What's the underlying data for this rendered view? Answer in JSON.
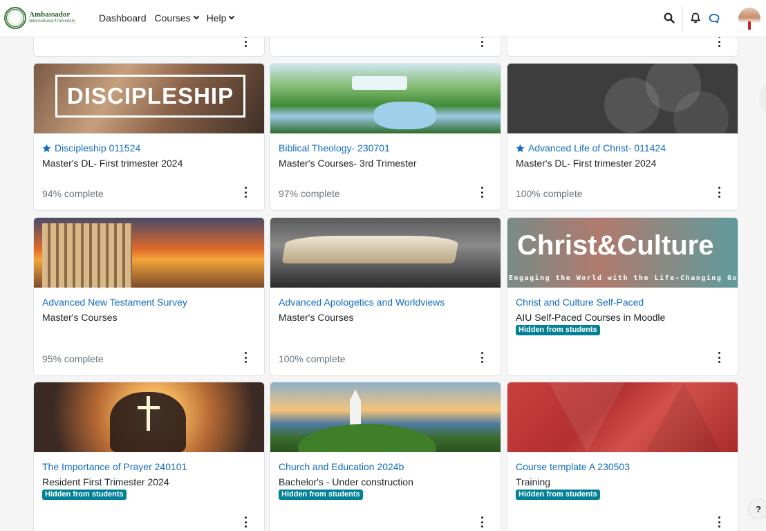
{
  "brand": {
    "name_line1": "Ambassador",
    "name_line2": "International University"
  },
  "nav": {
    "dashboard": "Dashboard",
    "courses": "Courses",
    "help": "Help"
  },
  "icons": {
    "search": "search-icon",
    "notifications": "bell-icon",
    "messages": "chat-icon"
  },
  "help_button": "?",
  "colors": {
    "link": "#0f6cbf",
    "badge": "#008196",
    "brand": "#2e5f2c"
  },
  "cards": [
    {
      "image_text": "DISCIPLESHIP",
      "starred": true,
      "title": "Discipleship 011524",
      "category": "Master's DL- First trimester 2024",
      "hidden": false,
      "progress": "94% complete"
    },
    {
      "image_text": "",
      "starred": false,
      "title": "Biblical Theology- 230701",
      "category": "Master's Courses- 3rd Trimester",
      "hidden": false,
      "progress": "97% complete"
    },
    {
      "image_text": "",
      "starred": true,
      "title": "Advanced Life of Christ- 011424",
      "category": "Master's DL- First trimester 2024",
      "hidden": false,
      "progress": "100% complete"
    },
    {
      "image_text": "",
      "starred": false,
      "title": "Advanced New Testament Survey",
      "category": "Master's Courses",
      "hidden": false,
      "progress": "95% complete"
    },
    {
      "image_text": "",
      "starred": false,
      "title": "Advanced Apologetics and Worldviews",
      "category": "Master's Courses",
      "hidden": false,
      "progress": "100% complete"
    },
    {
      "image_text": "Christ&Culture",
      "image_subtext": "Engaging the World with the Life-Changing Gospel",
      "starred": false,
      "title": "Christ and Culture Self-Paced",
      "category": "AIU Self-Paced Courses in Moodle",
      "hidden": true,
      "badge": "Hidden from students",
      "progress": ""
    },
    {
      "image_text": "",
      "starred": false,
      "title": "The Importance of Prayer 240101",
      "category": "Resident First Trimester 2024",
      "hidden": true,
      "badge": "Hidden from students",
      "progress": ""
    },
    {
      "image_text": "",
      "starred": false,
      "title": "Church and Education 2024b",
      "category": "Bachelor's - Under construction",
      "hidden": true,
      "badge": "Hidden from students",
      "progress": ""
    },
    {
      "image_text": "",
      "starred": false,
      "title": "Course template A 230503",
      "category": "Training",
      "hidden": true,
      "badge": "Hidden from students",
      "progress": ""
    }
  ]
}
